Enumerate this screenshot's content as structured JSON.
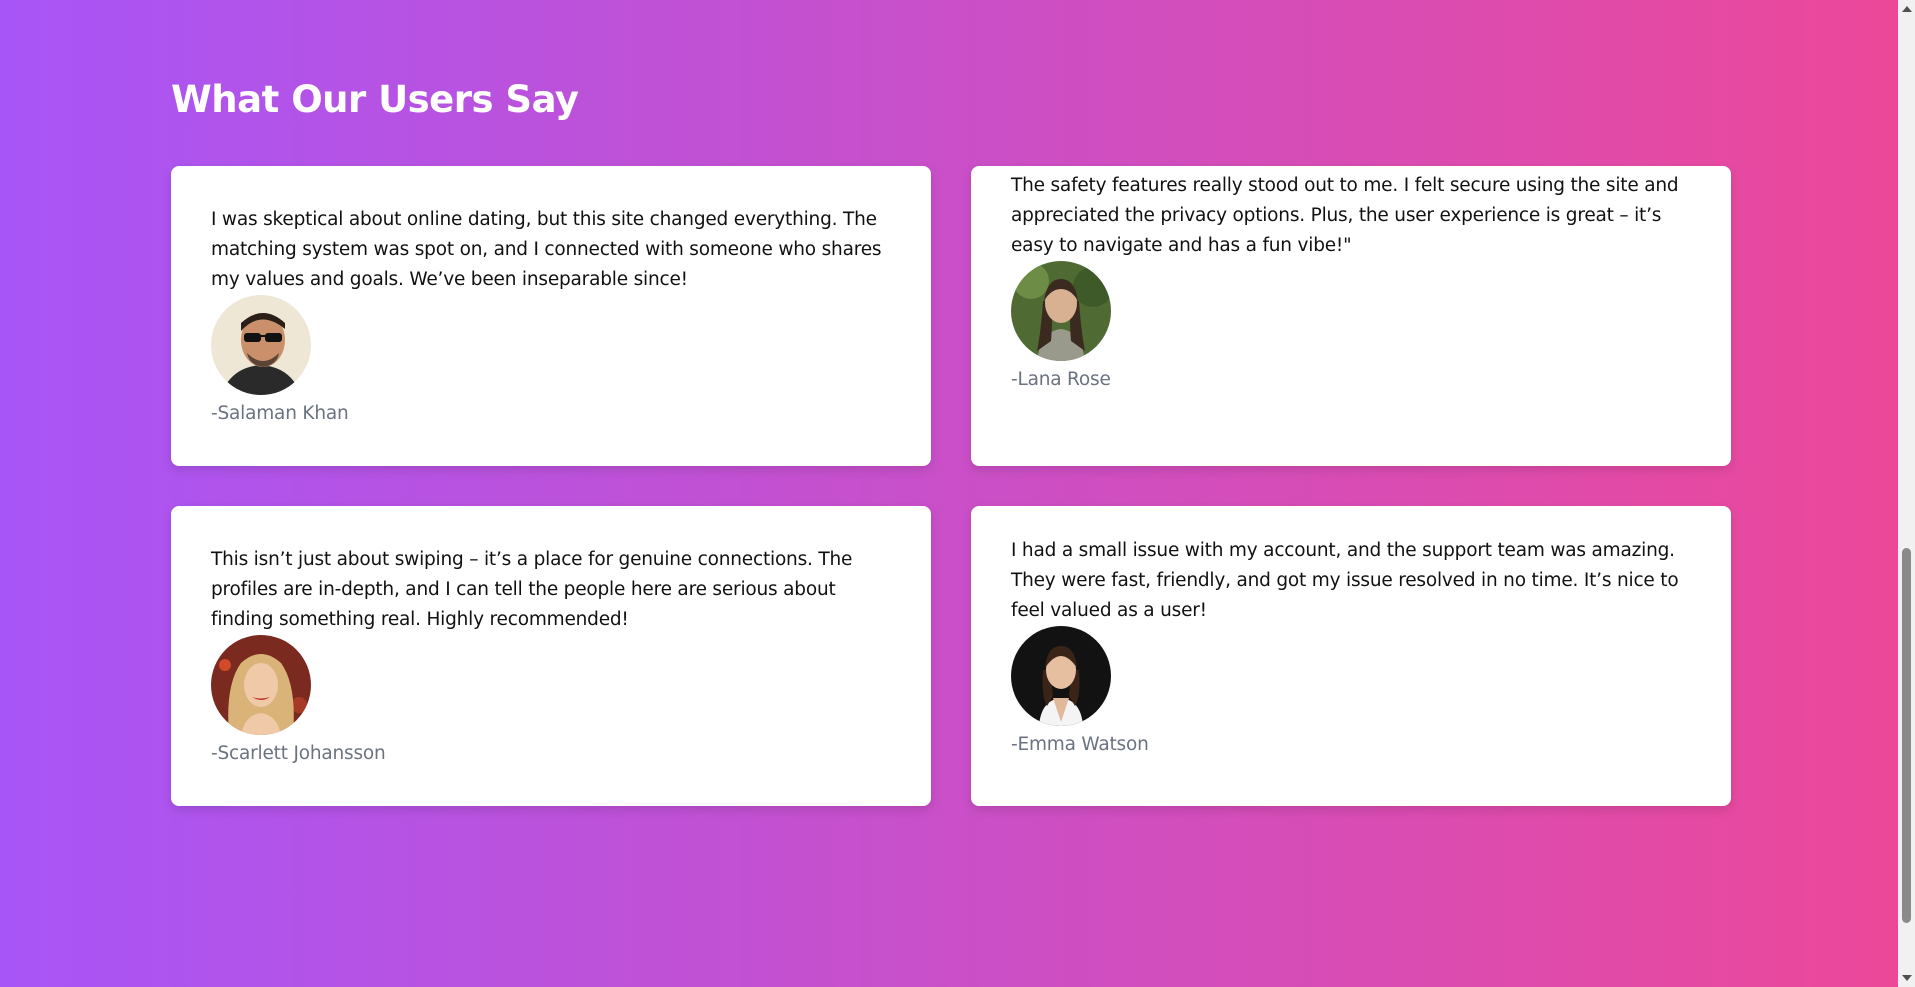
{
  "section": {
    "title": "What Our Users Say"
  },
  "testimonials": [
    {
      "quote": "I was skeptical about online dating, but this site changed everything. The matching system was spot on, and I connected with someone who shares my values and goals. We’ve been inseparable since!",
      "author": "-Salaman Khan",
      "avatar_icon": "man-with-sunglasses-avatar"
    },
    {
      "quote": "The safety features really stood out to me. I felt secure using the site and appreciated the privacy options. Plus, the user experience is great – it’s easy to navigate and has a fun vibe!\"",
      "author": "-Lana Rose",
      "avatar_icon": "woman-outdoors-avatar"
    },
    {
      "quote": "This isn’t just about swiping – it’s a place for genuine connections. The profiles are in-depth, and I can tell the people here are serious about finding something real. Highly recommended!",
      "author": "-Scarlett Johansson",
      "avatar_icon": "blonde-woman-avatar"
    },
    {
      "quote": "I had a small issue with my account, and the support team was amazing. They were fast, friendly, and got my issue resolved in no time. It’s nice to feel valued as a user!",
      "author": "-Emma Watson",
      "avatar_icon": "woman-white-dress-avatar"
    }
  ],
  "colors": {
    "gradient_start": "#a855f7",
    "gradient_end": "#ec4899",
    "card_bg": "#ffffff",
    "author_text": "#6b7280"
  }
}
